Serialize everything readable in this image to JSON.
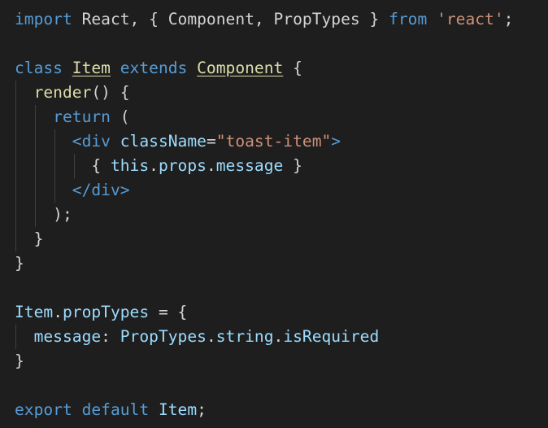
{
  "editor": {
    "theme_colors": {
      "background": "#1e1e1e",
      "keyword": "#569cd6",
      "control": "#c586c0",
      "type": "#dcdcaa",
      "string": "#ce9178",
      "variable": "#9cdcfe",
      "text": "#d4d4d4"
    },
    "lines": [
      {
        "tokens": [
          {
            "t": "import",
            "c": "kw"
          },
          {
            "t": " React, { Component, PropTypes } ",
            "c": "plain"
          },
          {
            "t": "from",
            "c": "kw"
          },
          {
            "t": " ",
            "c": "plain"
          },
          {
            "t": "'react'",
            "c": "str"
          },
          {
            "t": ";",
            "c": "plain"
          }
        ]
      },
      {
        "tokens": []
      },
      {
        "tokens": [
          {
            "t": "class",
            "c": "kw"
          },
          {
            "t": " ",
            "c": "plain"
          },
          {
            "t": "Item",
            "c": "cls"
          },
          {
            "t": " ",
            "c": "plain"
          },
          {
            "t": "extends",
            "c": "kw"
          },
          {
            "t": " ",
            "c": "plain"
          },
          {
            "t": "Component",
            "c": "cls"
          },
          {
            "t": " {",
            "c": "plain"
          }
        ]
      },
      {
        "tokens": [
          {
            "t": "  ",
            "c": "plain"
          },
          {
            "t": "render",
            "c": "fn"
          },
          {
            "t": "() {",
            "c": "plain"
          }
        ]
      },
      {
        "tokens": [
          {
            "t": "    ",
            "c": "plain"
          },
          {
            "t": "return",
            "c": "kw"
          },
          {
            "t": " (",
            "c": "plain"
          }
        ]
      },
      {
        "tokens": [
          {
            "t": "      ",
            "c": "plain"
          },
          {
            "t": "<div",
            "c": "tag"
          },
          {
            "t": " ",
            "c": "plain"
          },
          {
            "t": "className",
            "c": "var"
          },
          {
            "t": "=",
            "c": "plain"
          },
          {
            "t": "\"toast-item\"",
            "c": "str"
          },
          {
            "t": ">",
            "c": "tag"
          }
        ]
      },
      {
        "tokens": [
          {
            "t": "        { ",
            "c": "plain"
          },
          {
            "t": "this",
            "c": "var"
          },
          {
            "t": ".",
            "c": "plain"
          },
          {
            "t": "props",
            "c": "var"
          },
          {
            "t": ".",
            "c": "plain"
          },
          {
            "t": "message",
            "c": "var"
          },
          {
            "t": " }",
            "c": "plain"
          }
        ]
      },
      {
        "tokens": [
          {
            "t": "      ",
            "c": "plain"
          },
          {
            "t": "</div>",
            "c": "tag"
          }
        ]
      },
      {
        "tokens": [
          {
            "t": "    );",
            "c": "plain"
          }
        ]
      },
      {
        "tokens": [
          {
            "t": "  }",
            "c": "plain"
          }
        ]
      },
      {
        "tokens": [
          {
            "t": "}",
            "c": "plain"
          }
        ]
      },
      {
        "tokens": []
      },
      {
        "tokens": [
          {
            "t": "Item",
            "c": "var"
          },
          {
            "t": ".",
            "c": "plain"
          },
          {
            "t": "propTypes",
            "c": "var"
          },
          {
            "t": " = {",
            "c": "plain"
          }
        ]
      },
      {
        "tokens": [
          {
            "t": "  ",
            "c": "plain"
          },
          {
            "t": "message",
            "c": "var"
          },
          {
            "t": ": ",
            "c": "plain"
          },
          {
            "t": "PropTypes",
            "c": "var"
          },
          {
            "t": ".",
            "c": "plain"
          },
          {
            "t": "string",
            "c": "var"
          },
          {
            "t": ".",
            "c": "plain"
          },
          {
            "t": "isRequired",
            "c": "var"
          }
        ]
      },
      {
        "tokens": [
          {
            "t": "}",
            "c": "plain"
          }
        ]
      },
      {
        "tokens": []
      },
      {
        "tokens": [
          {
            "t": "export",
            "c": "kw"
          },
          {
            "t": " ",
            "c": "plain"
          },
          {
            "t": "default",
            "c": "kw"
          },
          {
            "t": " ",
            "c": "plain"
          },
          {
            "t": "Item",
            "c": "var"
          },
          {
            "t": ";",
            "c": "plain"
          }
        ]
      }
    ]
  }
}
